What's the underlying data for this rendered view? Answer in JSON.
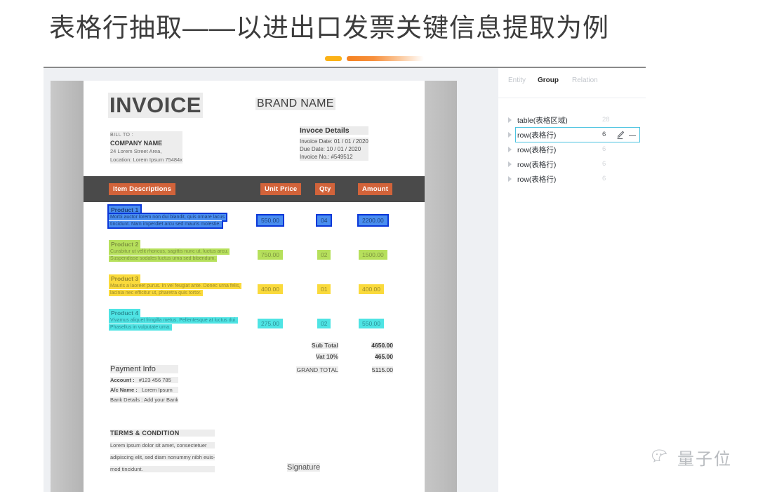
{
  "slide": {
    "title": "表格行抽取——以进出口发票关键信息提取为例",
    "accent_color_dash": "#fbb217",
    "accent_color_bar": "#f58220"
  },
  "document": {
    "invoice_title": "INVOICE",
    "brand_name": "BRAND NAME",
    "bill_to": {
      "label": "BILL TO :",
      "company": "COMPANY NAME",
      "address_line1": "24 Lorem Street Area,",
      "address_line2": "Location: Lorem Ipsum 75484x"
    },
    "invoice_details": {
      "heading": "Invoce Details",
      "invoice_date": "Invoice Date: 01 / 01 / 2020",
      "due_date": "Due Date: 10 / 01 / 2020",
      "invoice_no": "Invoice No.: #549512"
    },
    "table": {
      "headers": {
        "description": "Item Descriptions",
        "unit_price": "Unit Price",
        "qty": "Qty",
        "amount": "Amount"
      },
      "header_bg": "#4a4a4a",
      "header_label_bg": "#d2633a",
      "rows": [
        {
          "name": "Product 1",
          "desc": "Morbi auctor lorem non dui blandit, quis ornare lacus tincidunt. Nam imperdiet arcu sed mauris molestie.",
          "unit_price": "550.00",
          "qty": "04",
          "amount": "2200.00",
          "highlight": "blue",
          "selected": true
        },
        {
          "name": "Product 2",
          "desc": "Curabitur ut velit rhoncus, sagittis nunc ut, luctus arcu. Suspendisse sodales luctus urna sed bibendum.",
          "unit_price": "750.00",
          "qty": "02",
          "amount": "1500.00",
          "highlight": "green",
          "selected": false
        },
        {
          "name": "Product 3",
          "desc": "Mauris a laoreet purus. In vel feugiat ante. Donec urna felis, lacinia nec efficitur ut, pharetra quis tortor.",
          "unit_price": "400.00",
          "qty": "01",
          "amount": "400.00",
          "highlight": "yellow",
          "selected": false
        },
        {
          "name": "Product 4",
          "desc": "Vivamus aliquet fringilla metus. Pellentesque at luctus dui. Phasellus in vulputate urna.",
          "unit_price": "275.00",
          "qty": "02",
          "amount": "550.00",
          "highlight": "cyan",
          "selected": false
        }
      ]
    },
    "totals": [
      {
        "label": "Sub Total",
        "value": "4650.00",
        "bold": true
      },
      {
        "label": "Vat 10%",
        "value": "465.00",
        "bold": true
      },
      {
        "label": "GRAND TOTAL",
        "value": "5115.00",
        "bold": false
      }
    ],
    "payment_info": {
      "heading": "Payment Info",
      "account_label": "Account :",
      "account_value": "#123 456 785",
      "ac_name_label": "A/c Name :",
      "ac_name_value": "Lorem Ipsum",
      "bank_details": "Bank Details : Add your Bank"
    },
    "terms": {
      "heading": "TERMS & CONDITION",
      "line1": "Lorem ipsum dolor sit amet, consectetuer",
      "line2": "adipiscing elit, sed diam nonummy nibh euis-",
      "line3": "mod tincidunt."
    },
    "signature": "Signature"
  },
  "sidebar": {
    "tabs": [
      {
        "label": "Entity",
        "active": false
      },
      {
        "label": "Group",
        "active": true
      },
      {
        "label": "Relation",
        "active": false
      }
    ],
    "items": [
      {
        "label": "table(表格区域)",
        "count": "28",
        "selected": false
      },
      {
        "label": "row(表格行)",
        "count": "6",
        "selected": true
      },
      {
        "label": "row(表格行)",
        "count": "6",
        "selected": false
      },
      {
        "label": "row(表格行)",
        "count": "6",
        "selected": false
      },
      {
        "label": "row(表格行)",
        "count": "6",
        "selected": false
      }
    ],
    "selection_border_color": "#4cc3e0"
  },
  "watermark": {
    "text": "量子位",
    "icon": "wechat-icon"
  }
}
